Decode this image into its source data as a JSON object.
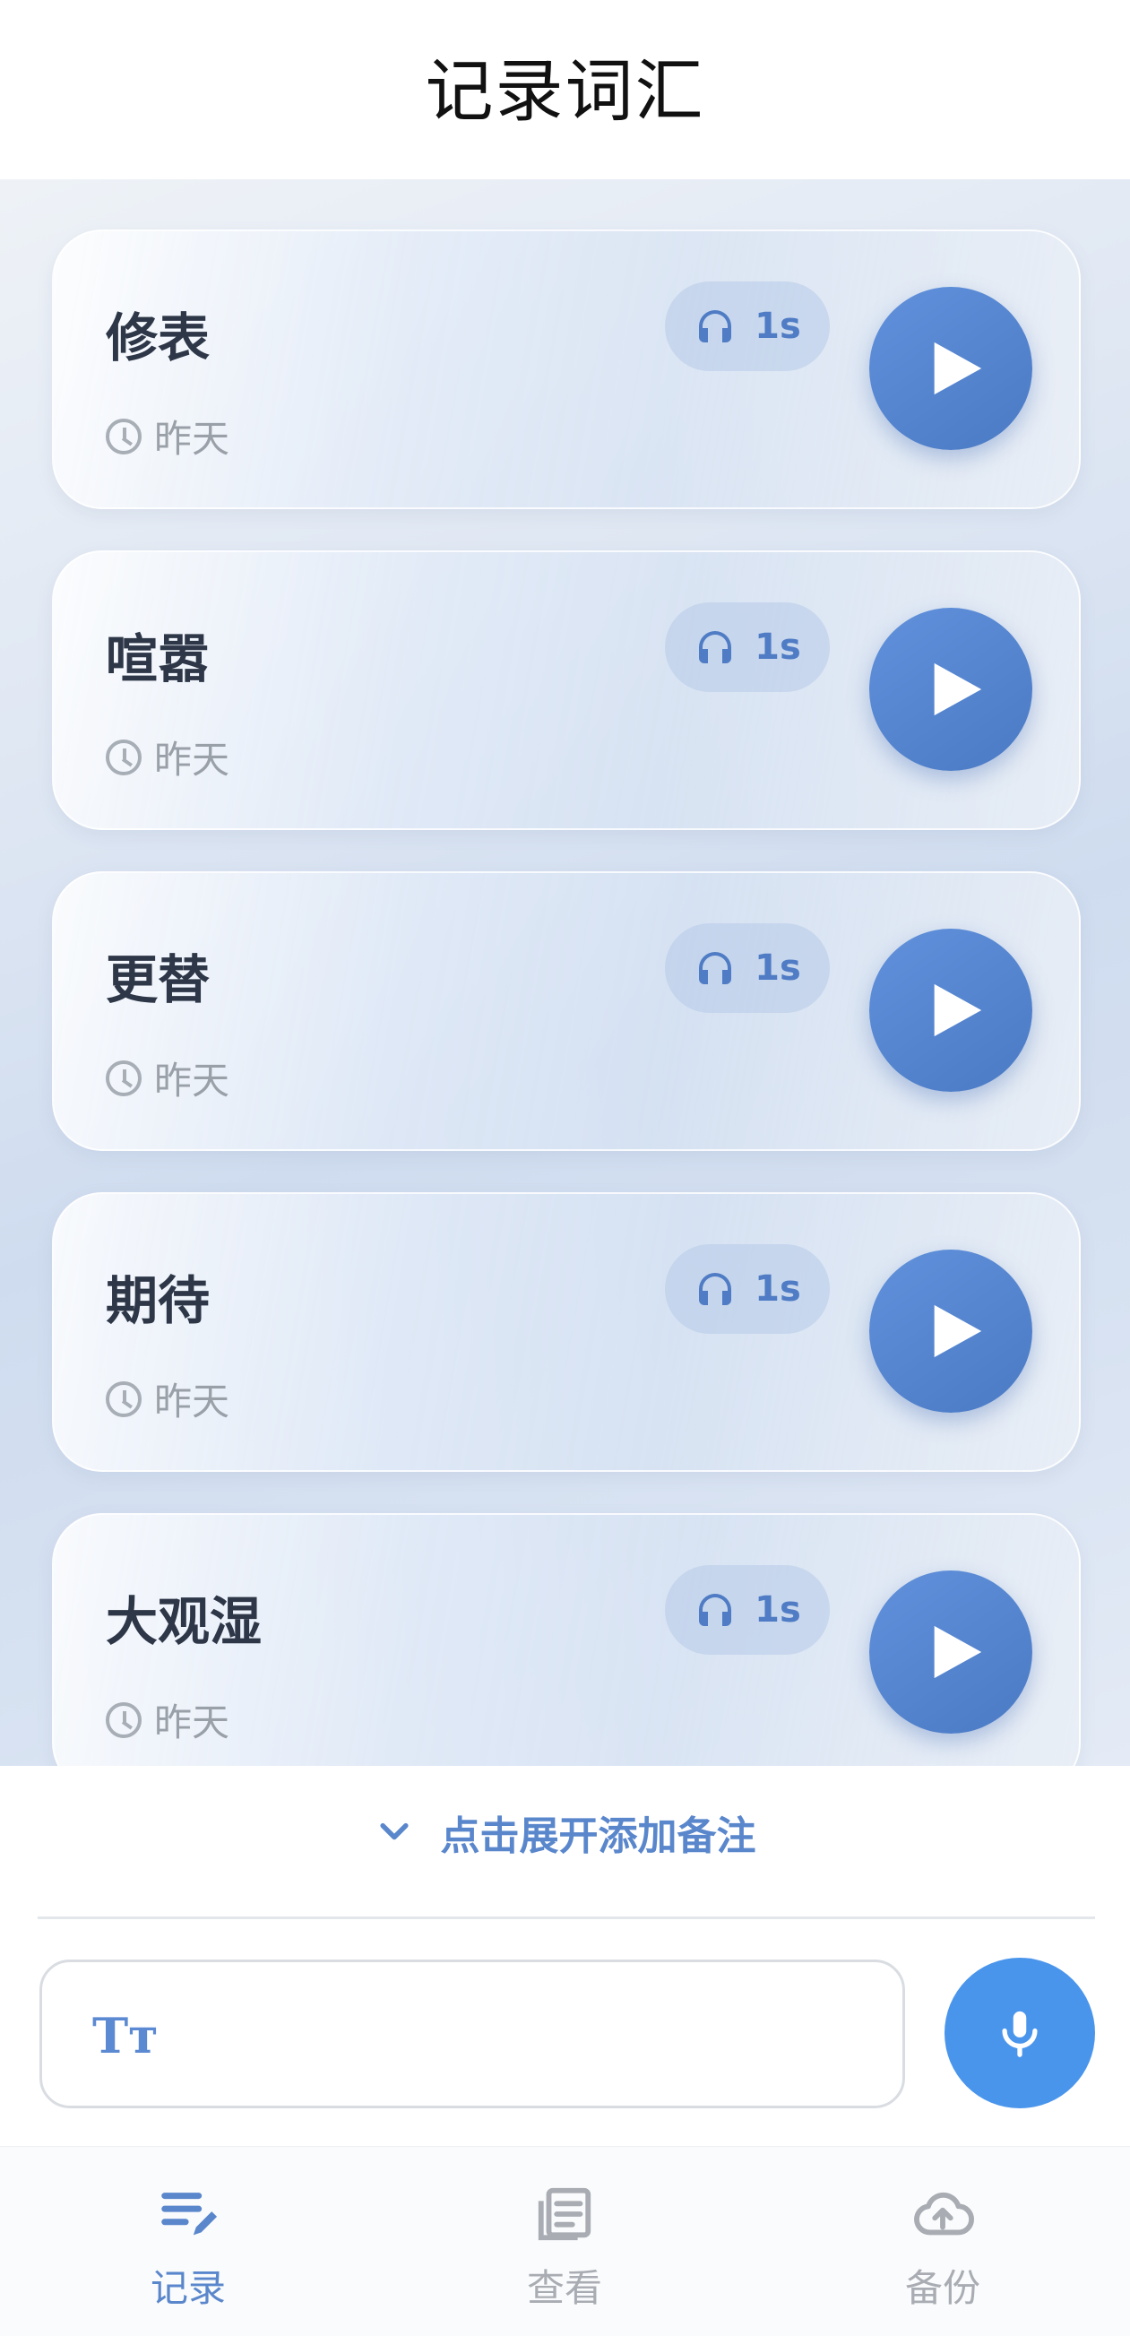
{
  "header": {
    "title": "记录词汇"
  },
  "records": [
    {
      "word": "修表",
      "time": "昨天",
      "duration": "1s"
    },
    {
      "word": "喧嚣",
      "time": "昨天",
      "duration": "1s"
    },
    {
      "word": "更替",
      "time": "昨天",
      "duration": "1s"
    },
    {
      "word": "期待",
      "time": "昨天",
      "duration": "1s"
    },
    {
      "word": "大观湿",
      "time": "昨天",
      "duration": "1s"
    }
  ],
  "composer": {
    "expand_label": "点击展开添加备注",
    "text_icon": "Tт"
  },
  "tabs": [
    {
      "label": "记录",
      "icon": "edit-list-icon",
      "active": true
    },
    {
      "label": "查看",
      "icon": "document-icon",
      "active": false
    },
    {
      "label": "备份",
      "icon": "cloud-upload-icon",
      "active": false
    }
  ],
  "colors": {
    "accent": "#5a87cc",
    "play_button": "#5585d2",
    "mic_button": "#4a95ec",
    "inactive": "#a9adb3"
  }
}
